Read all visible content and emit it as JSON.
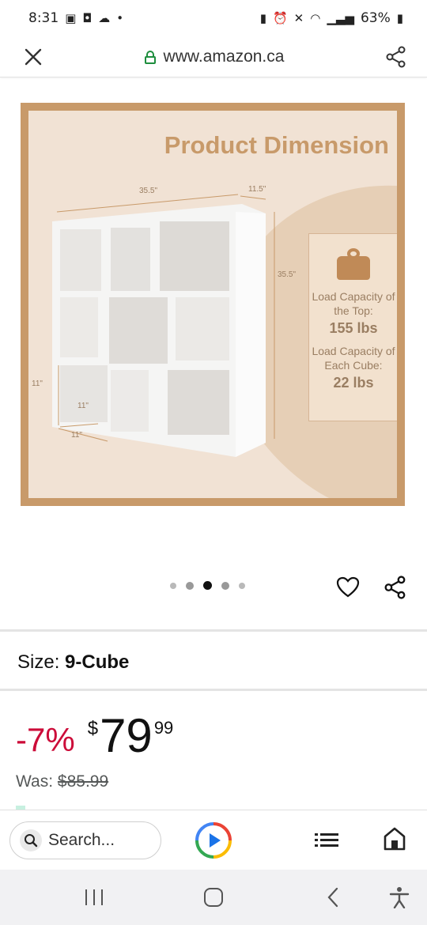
{
  "status_bar": {
    "time": "8:31",
    "battery": "63%"
  },
  "url_bar": {
    "domain": "www.amazon.ca"
  },
  "product_image": {
    "title": "Product Dimension",
    "dim_width": "35.5\"",
    "dim_depth": "11.5\"",
    "dim_height": "35.5\"",
    "dim_cube_height": "11\"",
    "dim_cube_width": "11\"",
    "dim_cube_depth": "11\"",
    "top_capacity_label": "Load Capacity of the Top:",
    "top_capacity_value": "155 lbs",
    "cube_capacity_label": "Load Capacity of Each Cube:",
    "cube_capacity_value": "22 lbs"
  },
  "carousel": {
    "total": 5,
    "active_index": 2
  },
  "size": {
    "label": "Size:",
    "value": "9-Cube"
  },
  "price": {
    "discount": "-7%",
    "currency": "$",
    "whole": "79",
    "fraction": "99",
    "was_label": "Was:",
    "was_value": "$85.99"
  },
  "bottom_toolbar": {
    "search_placeholder": "Search..."
  },
  "colors": {
    "discount_red": "#cc0c39",
    "image_border": "#c89a6a",
    "lock_green": "#1e8e3e"
  }
}
